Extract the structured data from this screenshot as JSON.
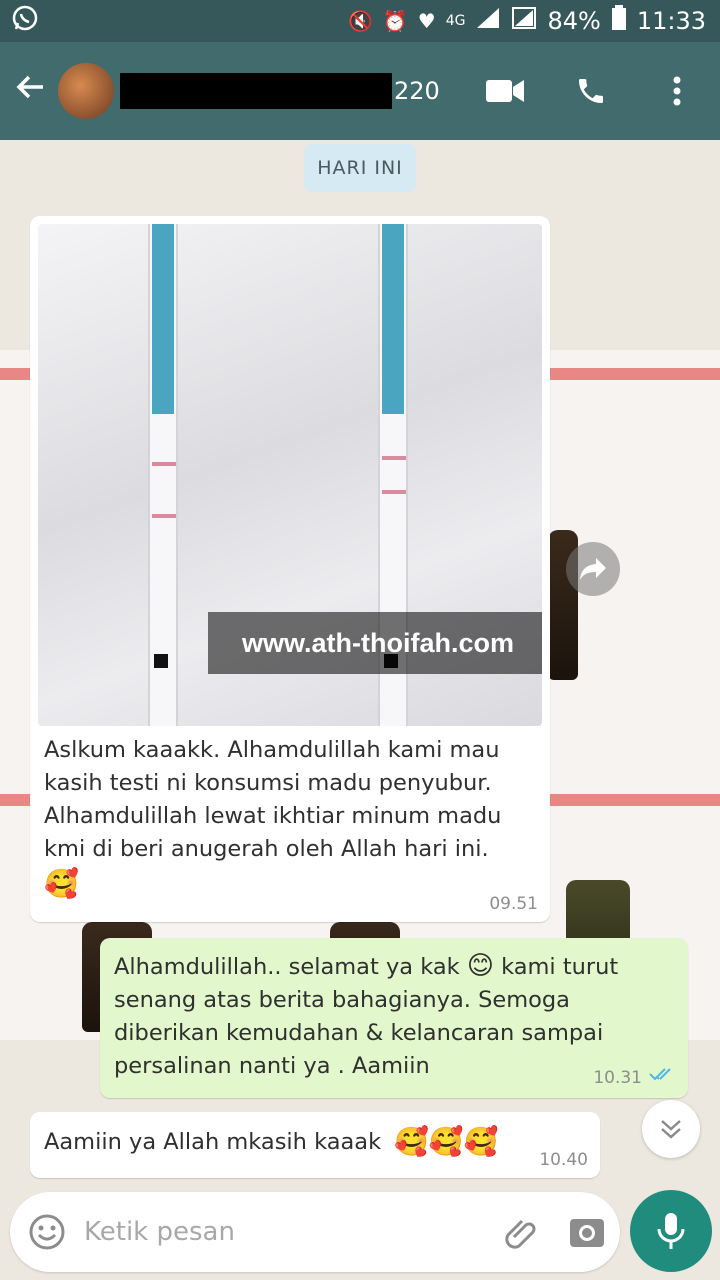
{
  "status_bar": {
    "battery": "84%",
    "time": "11:33",
    "network": "4G"
  },
  "header": {
    "contact_suffix": "220",
    "back_icon": "arrow-left-icon",
    "video_icon": "video-call-icon",
    "call_icon": "phone-icon",
    "menu_icon": "more-vert-icon"
  },
  "date_chip": "HARI INI",
  "messages": [
    {
      "direction": "incoming",
      "has_image": true,
      "image_watermark": "www.ath-thoifah.com",
      "text": "Aslkum kaaakk. Alhamdulillah kami mau kasih testi ni konsumsi madu penyubur. Alhamdulillah lewat ikhtiar minum madu kmi di beri anugerah oleh Allah hari ini.",
      "emoji": "🥰",
      "time": "09.51"
    },
    {
      "direction": "outgoing",
      "text_before_emoji": "Alhamdulillah.. selamat ya kak",
      "emoji": "😊",
      "text_after_emoji": "kami turut senang atas berita bahagianya. Semoga diberikan kemudahan & kelancaran sampai persalinan nanti ya . Aamiin",
      "time": "10.31",
      "status": "read"
    },
    {
      "direction": "incoming",
      "text": "Aamiin ya Allah mkasih kaaak",
      "emoji": "🥰🥰🥰",
      "time": "10.40"
    }
  ],
  "input": {
    "placeholder": "Ketik pesan"
  },
  "colors": {
    "header": "#426b6d",
    "status_bar": "#36585a",
    "outgoing_bubble": "#e2f7cb",
    "mic_button": "#1f8c7d",
    "read_ticks": "#4fb6ec"
  }
}
